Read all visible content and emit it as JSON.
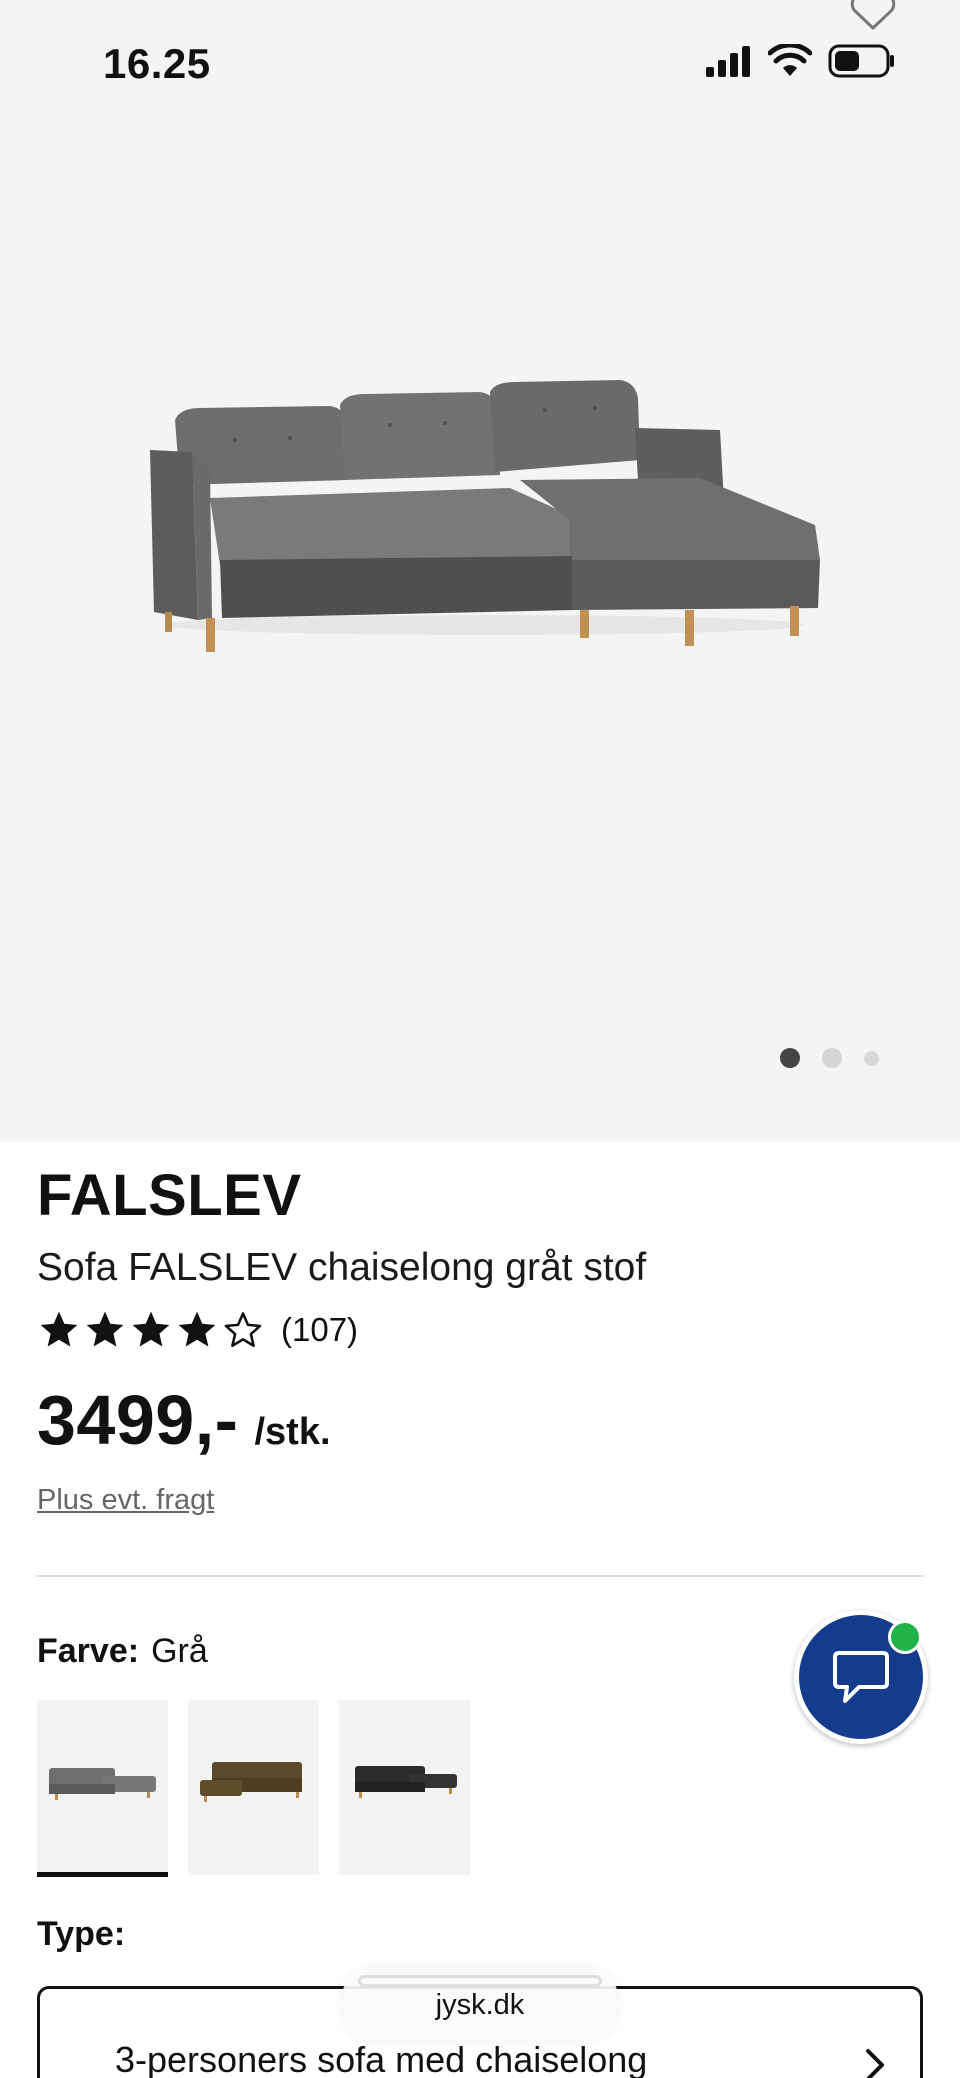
{
  "status_bar": {
    "time": "16.25"
  },
  "hero": {
    "image_alt": "Sofa FALSLEV chaiselong gråt stof",
    "gallery_total": 3,
    "gallery_active": 1
  },
  "product": {
    "brand": "FALSLEV",
    "subtitle": "Sofa FALSLEV chaiselong gråt stof",
    "rating": 4,
    "rating_max": 5,
    "review_count": "(107)",
    "price": "3499,-",
    "price_unit": "/stk.",
    "shipping_note": "Plus evt. fragt"
  },
  "color": {
    "label": "Farve:",
    "value": "Grå",
    "options": [
      {
        "name": "Grå",
        "color": "#6e6e6e",
        "selected": true
      },
      {
        "name": "Brun",
        "color": "#5b4a2a",
        "selected": false
      },
      {
        "name": "Sort",
        "color": "#2b2b2b",
        "selected": false
      }
    ]
  },
  "type": {
    "label": "Type:",
    "value": "3-personers sofa med chaiselong"
  },
  "browser": {
    "url": "jysk.dk"
  },
  "colors": {
    "accent": "#143c8c",
    "online": "#21b24a",
    "hero_bg": "#f4f4f4"
  },
  "icons": [
    "heart-icon",
    "signal-icon",
    "wifi-icon",
    "battery-icon",
    "star-icon",
    "chat-icon",
    "chevron-right-icon"
  ]
}
